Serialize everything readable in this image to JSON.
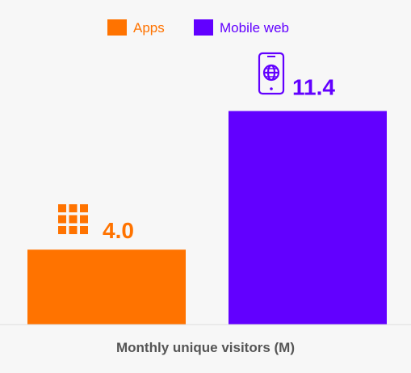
{
  "chart_data": {
    "type": "bar",
    "categories": [
      "Apps",
      "Mobile web"
    ],
    "series": [
      {
        "name": "Apps",
        "values": [
          4.0
        ],
        "color": "#ff7300"
      },
      {
        "name": "Mobile web",
        "values": [
          11.4
        ],
        "color": "#6200ff"
      }
    ],
    "value_labels": [
      "4.0",
      "11.4"
    ],
    "xlabel": "Monthly unique visitors (M)",
    "ylabel": "",
    "ylim": [
      0,
      15
    ],
    "grid": false,
    "legend_position": "top-center",
    "icons": [
      "app-grid-icon",
      "smartphone-globe-icon"
    ],
    "colors": {
      "apps": "#ff7300",
      "mobile_web": "#6200ff",
      "axis_band": "#ececec",
      "label_gray": "#555555"
    }
  }
}
